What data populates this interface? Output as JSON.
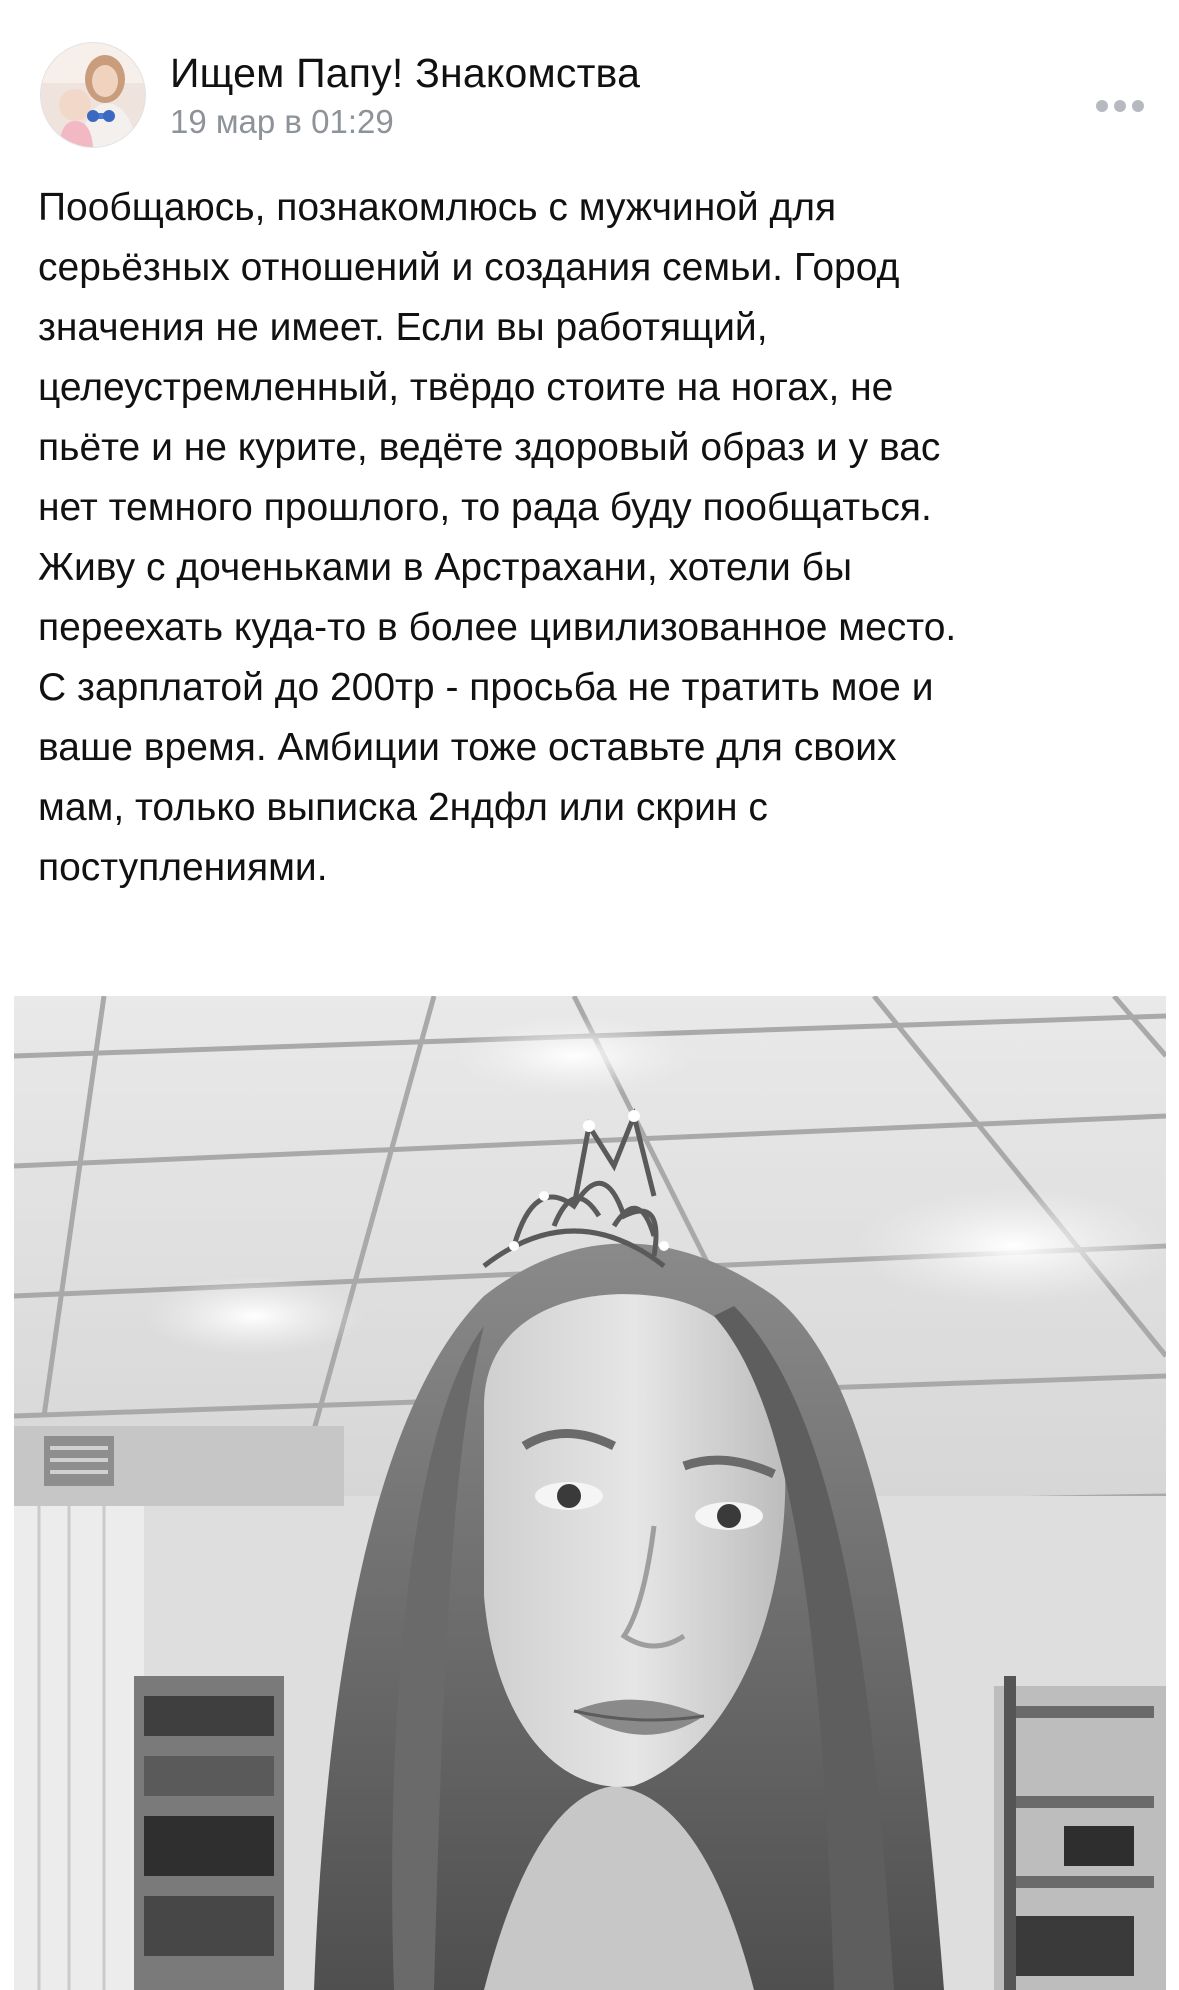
{
  "post": {
    "author": "Ищем Папу! Знакомства",
    "date": "19 мар в 01:29",
    "text_lines": [
      "Пообщаюсь, познакомлюсь с мужчиной для",
      "серьёзных отношений и создания семьи. Город",
      "значения не имеет. Если вы работящий,",
      "целеустремленный, твёрдо стоите на ногах, не",
      "пьёте и не курите, ведёте здоровый образ и у вас",
      "нет темного прошлого, то рада буду пообщаться.",
      "Живу с доченьками в Арстрахани, хотели бы",
      "переехать куда-то в более цивилизованное место.",
      "С зарплатой до 200тр - просьба не тратить мое и",
      "ваше время. Амбиции тоже оставьте для своих",
      "мам, только выписка 2ндфл или скрин с",
      "поступлениями."
    ]
  },
  "icons": {
    "more": "more-horizontal-icon"
  },
  "colors": {
    "text": "#111111",
    "secondary_text": "#8e9399",
    "icon": "#b6bac0",
    "background": "#ffffff"
  }
}
